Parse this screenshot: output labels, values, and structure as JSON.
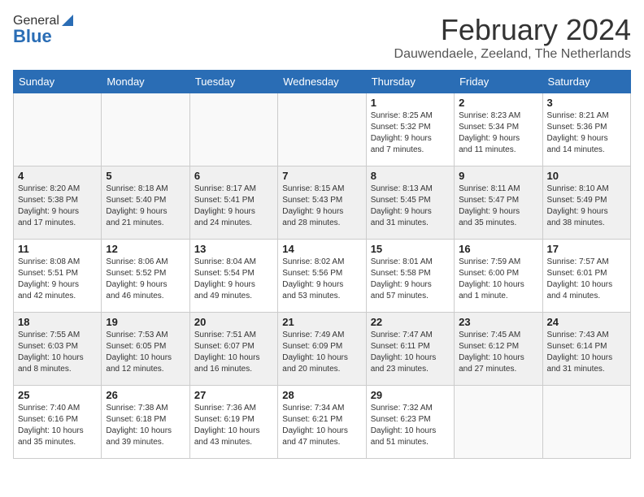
{
  "header": {
    "logo_general": "General",
    "logo_blue": "Blue",
    "title": "February 2024",
    "subtitle": "Dauwendaele, Zeeland, The Netherlands"
  },
  "days_of_week": [
    "Sunday",
    "Monday",
    "Tuesday",
    "Wednesday",
    "Thursday",
    "Friday",
    "Saturday"
  ],
  "weeks": [
    [
      {
        "day": "",
        "info": ""
      },
      {
        "day": "",
        "info": ""
      },
      {
        "day": "",
        "info": ""
      },
      {
        "day": "",
        "info": ""
      },
      {
        "day": "1",
        "info": "Sunrise: 8:25 AM\nSunset: 5:32 PM\nDaylight: 9 hours\nand 7 minutes."
      },
      {
        "day": "2",
        "info": "Sunrise: 8:23 AM\nSunset: 5:34 PM\nDaylight: 9 hours\nand 11 minutes."
      },
      {
        "day": "3",
        "info": "Sunrise: 8:21 AM\nSunset: 5:36 PM\nDaylight: 9 hours\nand 14 minutes."
      }
    ],
    [
      {
        "day": "4",
        "info": "Sunrise: 8:20 AM\nSunset: 5:38 PM\nDaylight: 9 hours\nand 17 minutes."
      },
      {
        "day": "5",
        "info": "Sunrise: 8:18 AM\nSunset: 5:40 PM\nDaylight: 9 hours\nand 21 minutes."
      },
      {
        "day": "6",
        "info": "Sunrise: 8:17 AM\nSunset: 5:41 PM\nDaylight: 9 hours\nand 24 minutes."
      },
      {
        "day": "7",
        "info": "Sunrise: 8:15 AM\nSunset: 5:43 PM\nDaylight: 9 hours\nand 28 minutes."
      },
      {
        "day": "8",
        "info": "Sunrise: 8:13 AM\nSunset: 5:45 PM\nDaylight: 9 hours\nand 31 minutes."
      },
      {
        "day": "9",
        "info": "Sunrise: 8:11 AM\nSunset: 5:47 PM\nDaylight: 9 hours\nand 35 minutes."
      },
      {
        "day": "10",
        "info": "Sunrise: 8:10 AM\nSunset: 5:49 PM\nDaylight: 9 hours\nand 38 minutes."
      }
    ],
    [
      {
        "day": "11",
        "info": "Sunrise: 8:08 AM\nSunset: 5:51 PM\nDaylight: 9 hours\nand 42 minutes."
      },
      {
        "day": "12",
        "info": "Sunrise: 8:06 AM\nSunset: 5:52 PM\nDaylight: 9 hours\nand 46 minutes."
      },
      {
        "day": "13",
        "info": "Sunrise: 8:04 AM\nSunset: 5:54 PM\nDaylight: 9 hours\nand 49 minutes."
      },
      {
        "day": "14",
        "info": "Sunrise: 8:02 AM\nSunset: 5:56 PM\nDaylight: 9 hours\nand 53 minutes."
      },
      {
        "day": "15",
        "info": "Sunrise: 8:01 AM\nSunset: 5:58 PM\nDaylight: 9 hours\nand 57 minutes."
      },
      {
        "day": "16",
        "info": "Sunrise: 7:59 AM\nSunset: 6:00 PM\nDaylight: 10 hours\nand 1 minute."
      },
      {
        "day": "17",
        "info": "Sunrise: 7:57 AM\nSunset: 6:01 PM\nDaylight: 10 hours\nand 4 minutes."
      }
    ],
    [
      {
        "day": "18",
        "info": "Sunrise: 7:55 AM\nSunset: 6:03 PM\nDaylight: 10 hours\nand 8 minutes."
      },
      {
        "day": "19",
        "info": "Sunrise: 7:53 AM\nSunset: 6:05 PM\nDaylight: 10 hours\nand 12 minutes."
      },
      {
        "day": "20",
        "info": "Sunrise: 7:51 AM\nSunset: 6:07 PM\nDaylight: 10 hours\nand 16 minutes."
      },
      {
        "day": "21",
        "info": "Sunrise: 7:49 AM\nSunset: 6:09 PM\nDaylight: 10 hours\nand 20 minutes."
      },
      {
        "day": "22",
        "info": "Sunrise: 7:47 AM\nSunset: 6:11 PM\nDaylight: 10 hours\nand 23 minutes."
      },
      {
        "day": "23",
        "info": "Sunrise: 7:45 AM\nSunset: 6:12 PM\nDaylight: 10 hours\nand 27 minutes."
      },
      {
        "day": "24",
        "info": "Sunrise: 7:43 AM\nSunset: 6:14 PM\nDaylight: 10 hours\nand 31 minutes."
      }
    ],
    [
      {
        "day": "25",
        "info": "Sunrise: 7:40 AM\nSunset: 6:16 PM\nDaylight: 10 hours\nand 35 minutes."
      },
      {
        "day": "26",
        "info": "Sunrise: 7:38 AM\nSunset: 6:18 PM\nDaylight: 10 hours\nand 39 minutes."
      },
      {
        "day": "27",
        "info": "Sunrise: 7:36 AM\nSunset: 6:19 PM\nDaylight: 10 hours\nand 43 minutes."
      },
      {
        "day": "28",
        "info": "Sunrise: 7:34 AM\nSunset: 6:21 PM\nDaylight: 10 hours\nand 47 minutes."
      },
      {
        "day": "29",
        "info": "Sunrise: 7:32 AM\nSunset: 6:23 PM\nDaylight: 10 hours\nand 51 minutes."
      },
      {
        "day": "",
        "info": ""
      },
      {
        "day": "",
        "info": ""
      }
    ]
  ]
}
